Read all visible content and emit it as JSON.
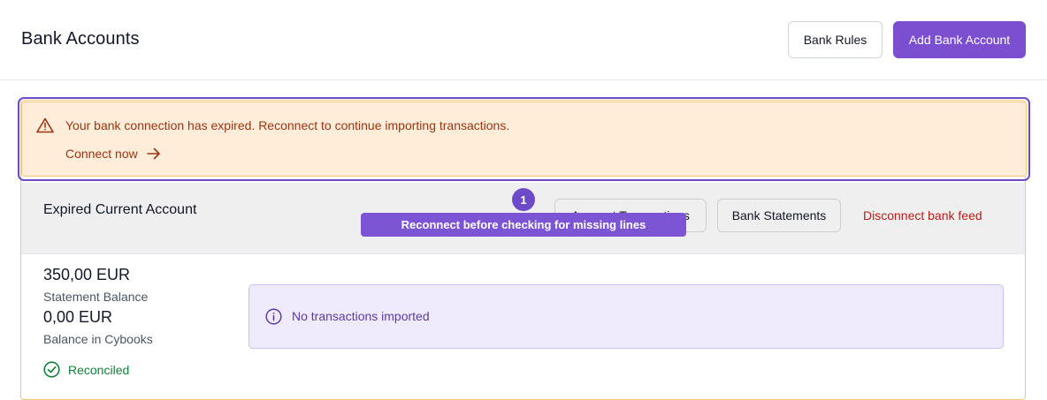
{
  "header": {
    "title": "Bank Accounts",
    "bank_rules_label": "Bank Rules",
    "add_account_label": "Add Bank Account"
  },
  "alert": {
    "message": "Your bank connection has expired. Reconnect to continue importing transactions.",
    "link_label": "Connect now",
    "icon": "warning-triangle-icon",
    "link_icon": "arrow-right-icon"
  },
  "account": {
    "name": "Expired Current Account",
    "import_label": "Account Transactions",
    "statements_label": "Bank Statements",
    "disconnect_label": "Disconnect bank feed",
    "statement_balance": "350,00 EUR",
    "statement_balance_label": "Statement Balance",
    "book_balance": "0,00 EUR",
    "book_balance_label": "Balance in Cybooks",
    "status_label": "Reconciled",
    "status_icon": "check-circle-icon",
    "info_message": "No transactions imported",
    "info_icon": "info-circle-icon"
  },
  "coachmark": {
    "step": "1",
    "text": "Reconnect before checking for missing lines"
  },
  "colors": {
    "primary": "#7c4fd1",
    "alert_bg": "#ffedd9",
    "alert_text": "#9a3412",
    "danger": "#b91c1c",
    "success": "#15803d",
    "info_bg": "#efebfc"
  }
}
